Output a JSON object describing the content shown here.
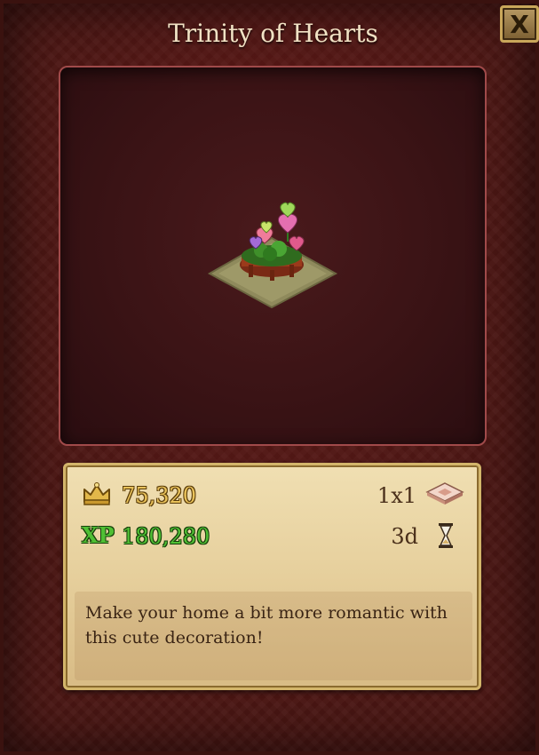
{
  "dialog": {
    "title": "Trinity of Hearts",
    "close_label": "X"
  },
  "item": {
    "cost": "75,320",
    "xp_label": "XP",
    "xp": "180,280",
    "size": "1x1",
    "build_time": "3d",
    "description": "Make your home a bit more romantic with this cute decoration!"
  },
  "icons": {
    "cost": "crown-icon",
    "xp": "xp-icon",
    "size": "tile-icon",
    "time": "hourglass-icon",
    "close": "close-icon"
  },
  "colors": {
    "background": "#4b1714",
    "gold_value": "#e8c15a",
    "xp_value": "#4fbf34",
    "info_panel": "#e6cf9c"
  }
}
